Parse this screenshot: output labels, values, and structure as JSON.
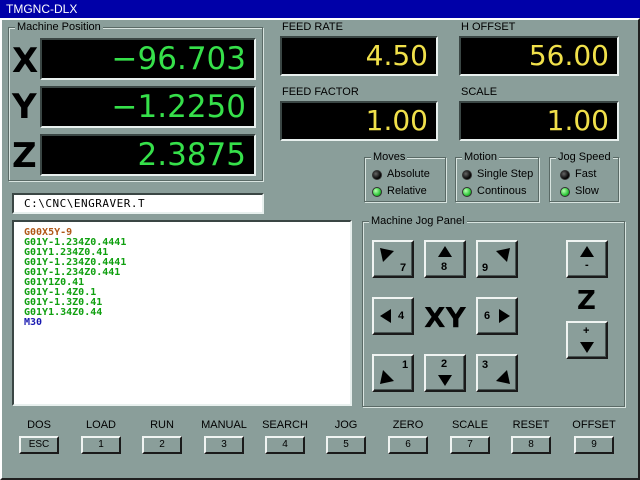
{
  "window": {
    "title": "TMGNC-DLX"
  },
  "machine_position": {
    "title": "Machine Position",
    "axes": [
      {
        "letter": "X",
        "value": "−96.703"
      },
      {
        "letter": "Y",
        "value": "−1.2250"
      },
      {
        "letter": "Z",
        "value": "2.3875"
      }
    ]
  },
  "readouts": {
    "feed_rate": {
      "label": "FEED RATE",
      "value": "4.50"
    },
    "h_offset": {
      "label": "H OFFSET",
      "value": "56.00"
    },
    "feed_factor": {
      "label": "FEED FACTOR",
      "value": "1.00"
    },
    "scale": {
      "label": "SCALE",
      "value": "1.00"
    }
  },
  "moves": {
    "title": "Moves",
    "options": [
      "Absolute",
      "Relative"
    ],
    "selected": "Relative"
  },
  "motion": {
    "title": "Motion",
    "options": [
      "Single Step",
      "Continous"
    ],
    "selected": "Continous"
  },
  "jog_speed": {
    "title": "Jog Speed",
    "options": [
      "Fast",
      "Slow"
    ],
    "selected": "Slow"
  },
  "file": {
    "path": "C:\\CNC\\ENGRAVER.T"
  },
  "program": {
    "lines": [
      {
        "text": "G00X5Y-9",
        "color": "#b05818"
      },
      {
        "text": "G01Y-1.234Z0.4441",
        "color": "#10a010"
      },
      {
        "text": "G01Y1.234Z0.41",
        "color": "#10a010"
      },
      {
        "text": "G01Y-1.234Z0.4441",
        "color": "#10a010"
      },
      {
        "text": "G01Y-1.234Z0.441",
        "color": "#10a010"
      },
      {
        "text": "G01Y1Z0.41",
        "color": "#10a010"
      },
      {
        "text": "G01Y-1.4Z0.1",
        "color": "#10a010"
      },
      {
        "text": "G01Y-1.3Z0.41",
        "color": "#10a010"
      },
      {
        "text": "G01Y1.34Z0.44",
        "color": "#10a010"
      },
      {
        "text": "M30",
        "color": "#1818b0"
      }
    ]
  },
  "jog_panel": {
    "title": "Machine Jog Panel",
    "xy_label": "XY",
    "z_label": "Z",
    "buttons": [
      {
        "id": "7",
        "icon": "arrow-up-left-icon"
      },
      {
        "id": "8",
        "icon": "arrow-up-icon"
      },
      {
        "id": "9",
        "icon": "arrow-up-right-icon"
      },
      {
        "id": "4",
        "icon": "arrow-left-icon"
      },
      {
        "id": "6",
        "icon": "arrow-right-icon"
      },
      {
        "id": "1",
        "icon": "arrow-down-left-icon"
      },
      {
        "id": "2",
        "icon": "arrow-down-icon"
      },
      {
        "id": "3",
        "icon": "arrow-down-right-icon"
      }
    ],
    "z_buttons": [
      {
        "id": "-",
        "icon": "arrow-up-icon"
      },
      {
        "id": "+",
        "icon": "arrow-down-icon"
      }
    ]
  },
  "function_keys": [
    {
      "label": "DOS",
      "key": "ESC"
    },
    {
      "label": "LOAD",
      "key": "1"
    },
    {
      "label": "RUN",
      "key": "2"
    },
    {
      "label": "MANUAL",
      "key": "3"
    },
    {
      "label": "SEARCH",
      "key": "4"
    },
    {
      "label": "JOG",
      "key": "5"
    },
    {
      "label": "ZERO",
      "key": "6"
    },
    {
      "label": "SCALE",
      "key": "7"
    },
    {
      "label": "RESET",
      "key": "8"
    },
    {
      "label": "OFFSET",
      "key": "9"
    }
  ]
}
